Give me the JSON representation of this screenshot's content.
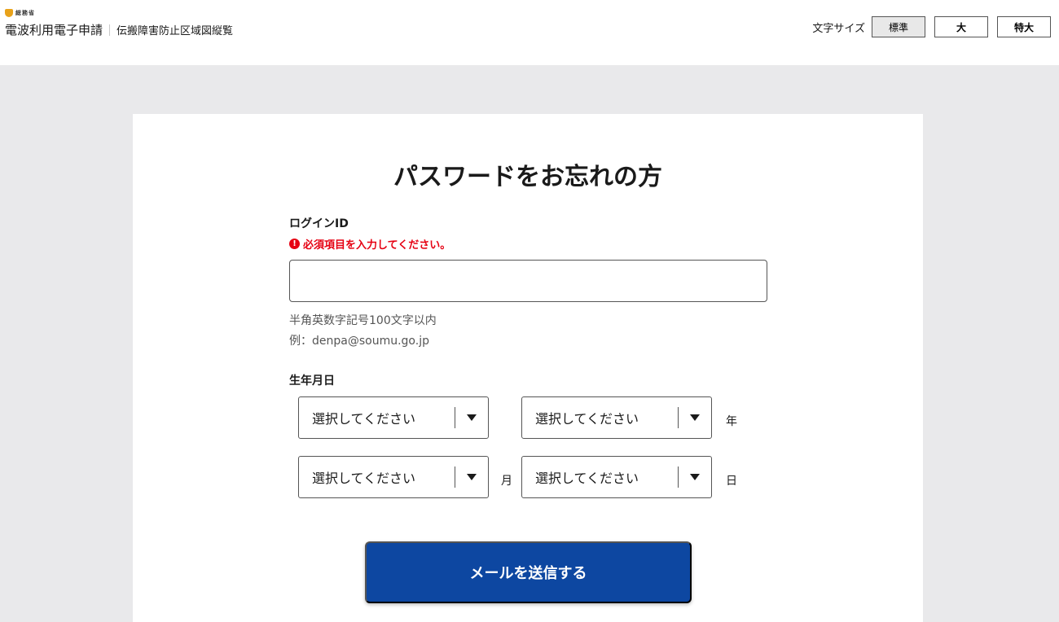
{
  "header": {
    "ministry_name": "総務省",
    "site_title": "電波利用電子申請",
    "site_subtitle": "伝搬障害防止区域図縦覧",
    "font_size_label": "文字サイズ",
    "font_size_options": [
      "標準",
      "大",
      "特大"
    ],
    "font_size_selected": "標準"
  },
  "form": {
    "title": "パスワードをお忘れの方",
    "login_id": {
      "label": "ログインID",
      "error": "必須項目を入力してください。",
      "value": "",
      "hint_line1": "半角英数字記号100文字以内",
      "hint_line2": "例：denpa@soumu.go.jp"
    },
    "birthdate": {
      "label": "生年月日",
      "year_selects": [
        "選択してください",
        "選択してください"
      ],
      "year_unit": "年",
      "month_select": "選択してください",
      "month_unit": "月",
      "day_select": "選択してください",
      "day_unit": "日"
    },
    "submit_label": "メールを送信する"
  },
  "colors": {
    "primary": "#0d47a1",
    "error": "#e60012",
    "background": "#e9e9eb"
  }
}
